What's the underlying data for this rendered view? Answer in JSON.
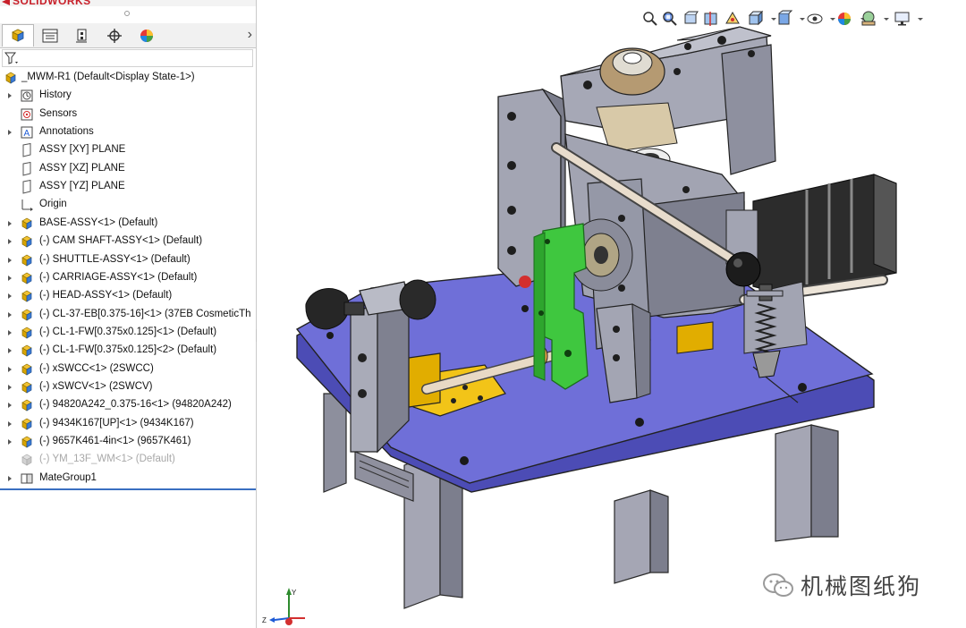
{
  "brand": "SOLIDWORKS",
  "tabs": [
    {
      "name": "featuremanager-design-tree",
      "icon": "feature-tree-icon",
      "active": true
    },
    {
      "name": "property-manager",
      "icon": "property-manager-icon"
    },
    {
      "name": "configuration-manager",
      "icon": "configuration-manager-icon"
    },
    {
      "name": "dimxpert-manager",
      "icon": "dimxpert-icon"
    },
    {
      "name": "display-manager",
      "icon": "display-manager-icon"
    }
  ],
  "tree": {
    "root": "_MWM-R1  (Default<Display State-1>)",
    "items": [
      {
        "label": "History",
        "icon": "history-icon",
        "expand": true
      },
      {
        "label": "Sensors",
        "icon": "sensors-icon",
        "expand": false
      },
      {
        "label": "Annotations",
        "icon": "annotations-icon",
        "expand": true
      },
      {
        "label": "ASSY [XY] PLANE",
        "icon": "plane-icon",
        "expand": false
      },
      {
        "label": "ASSY [XZ] PLANE",
        "icon": "plane-icon",
        "expand": false
      },
      {
        "label": "ASSY [YZ] PLANE",
        "icon": "plane-icon",
        "expand": false
      },
      {
        "label": "Origin",
        "icon": "origin-icon",
        "expand": false
      },
      {
        "label": "BASE-ASSY<1> (Default)",
        "icon": "assembly-icon",
        "expand": true
      },
      {
        "label": "(-) CAM SHAFT-ASSY<1> (Default)",
        "icon": "assembly-icon",
        "expand": true
      },
      {
        "label": "(-) SHUTTLE-ASSY<1> (Default)",
        "icon": "assembly-icon",
        "expand": true
      },
      {
        "label": "(-) CARRIAGE-ASSY<1> (Default)",
        "icon": "assembly-icon",
        "expand": true
      },
      {
        "label": "(-) HEAD-ASSY<1> (Default)",
        "icon": "assembly-icon",
        "expand": true
      },
      {
        "label": "(-) CL-37-EB[0.375-16]<1> (37EB CosmeticTh",
        "icon": "assembly-icon",
        "expand": true
      },
      {
        "label": "(-) CL-1-FW[0.375x0.125]<1> (Default)",
        "icon": "assembly-icon",
        "expand": true
      },
      {
        "label": "(-) CL-1-FW[0.375x0.125]<2> (Default)",
        "icon": "assembly-icon",
        "expand": true
      },
      {
        "label": "(-) xSWCC<1> (2SWCC)",
        "icon": "assembly-icon",
        "expand": true
      },
      {
        "label": "(-) xSWCV<1> (2SWCV)",
        "icon": "assembly-icon",
        "expand": true
      },
      {
        "label": "(-) 94820A242_0.375-16<1> (94820A242)",
        "icon": "assembly-icon",
        "expand": true
      },
      {
        "label": "(-) 9434K167[UP]<1> (9434K167)",
        "icon": "assembly-icon",
        "expand": true
      },
      {
        "label": "(-) 9657K461-4in<1> (9657K461)",
        "icon": "assembly-icon",
        "expand": true
      },
      {
        "label": "(-) YM_13F_WM<1> (Default)",
        "icon": "suppressed-part-icon",
        "expand": false,
        "dim": true
      },
      {
        "label": "MateGroup1",
        "icon": "mategroup-icon",
        "expand": true
      }
    ]
  },
  "hud": {
    "buttons": [
      "zoom-to-fit-icon",
      "zoom-to-area-icon",
      "previous-view-icon",
      "section-view-icon",
      "dynamic-annotation-icon",
      "view-orientation-icon",
      "display-style-icon",
      "hide-show-icon",
      "edit-appearance-icon",
      "apply-scene-icon",
      "view-settings-icon"
    ]
  },
  "watermark": "机械图纸狗",
  "triad": {
    "x": "X",
    "y": "Y",
    "z": "Z"
  },
  "colors": {
    "plate": "#6f6fd8",
    "frame": "#a7a9b4",
    "green": "#3fc73f",
    "yellow": "#f2c418",
    "motor": "#2c2c2c",
    "accent": "#c8202a"
  }
}
